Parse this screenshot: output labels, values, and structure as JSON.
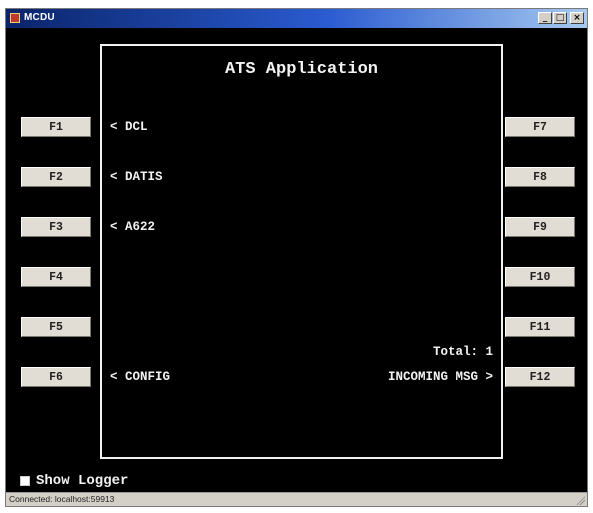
{
  "window": {
    "title": "MCDU",
    "minimize_glyph": "_",
    "maximize_glyph": "□",
    "close_glyph": "×"
  },
  "screen": {
    "title": "ATS Application",
    "left_labels": {
      "l1": "< DCL",
      "l2": "< DATIS",
      "l3": "< A622",
      "l6": "< CONFIG"
    },
    "right_labels": {
      "r6": "INCOMING MSG >"
    },
    "total": "Total: 1"
  },
  "function_keys": {
    "left": [
      "F1",
      "F2",
      "F3",
      "F4",
      "F5",
      "F6"
    ],
    "right": [
      "F7",
      "F8",
      "F9",
      "F10",
      "F11",
      "F12"
    ]
  },
  "logger": {
    "label": "Show Logger",
    "checked": false
  },
  "status_bar": {
    "text": "Connected: localhost:59913"
  },
  "colors": {
    "title_bar_start": "#0a246a",
    "title_bar_end": "#a6caf0",
    "screen_bg": "#000000",
    "screen_text": "#f2f2f2",
    "key_face": "#e2ddd4"
  }
}
